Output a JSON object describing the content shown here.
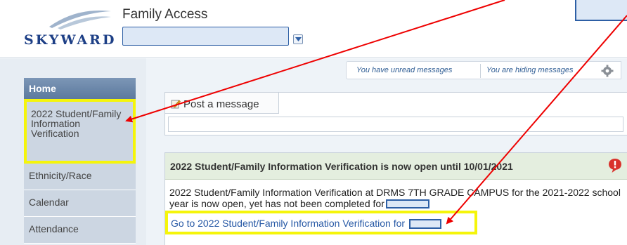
{
  "header": {
    "logo_text": "SKYWARD",
    "app_title": "Family Access"
  },
  "sidebar": {
    "items": [
      {
        "label": "Home"
      },
      {
        "label": "2022 Student/Family Information Verification"
      },
      {
        "label": "Ethnicity/Race"
      },
      {
        "label": "Calendar"
      },
      {
        "label": "Attendance"
      }
    ]
  },
  "messages": {
    "unread": "You have unread messages",
    "hiding": "You are hiding messages"
  },
  "post": {
    "tab_label": "Post a message"
  },
  "notice": {
    "title": "2022 Student/Family Information Verification is now open until 10/01/2021",
    "body": "2022 Student/Family Information Verification at DRMS 7TH GRADE CAMPUS for the 2021-2022 school year is now open, yet has not been completed for",
    "link": "Go to 2022 Student/Family Information Verification for"
  },
  "colors": {
    "highlight": "#f5f50a",
    "arrow": "#ee0000",
    "link": "#2658a5",
    "nav_home": "#5c7a9e"
  },
  "icons": [
    "dropdown-arrow-icon",
    "gear-icon",
    "pencil-note-icon",
    "alert-bubble-icon"
  ]
}
